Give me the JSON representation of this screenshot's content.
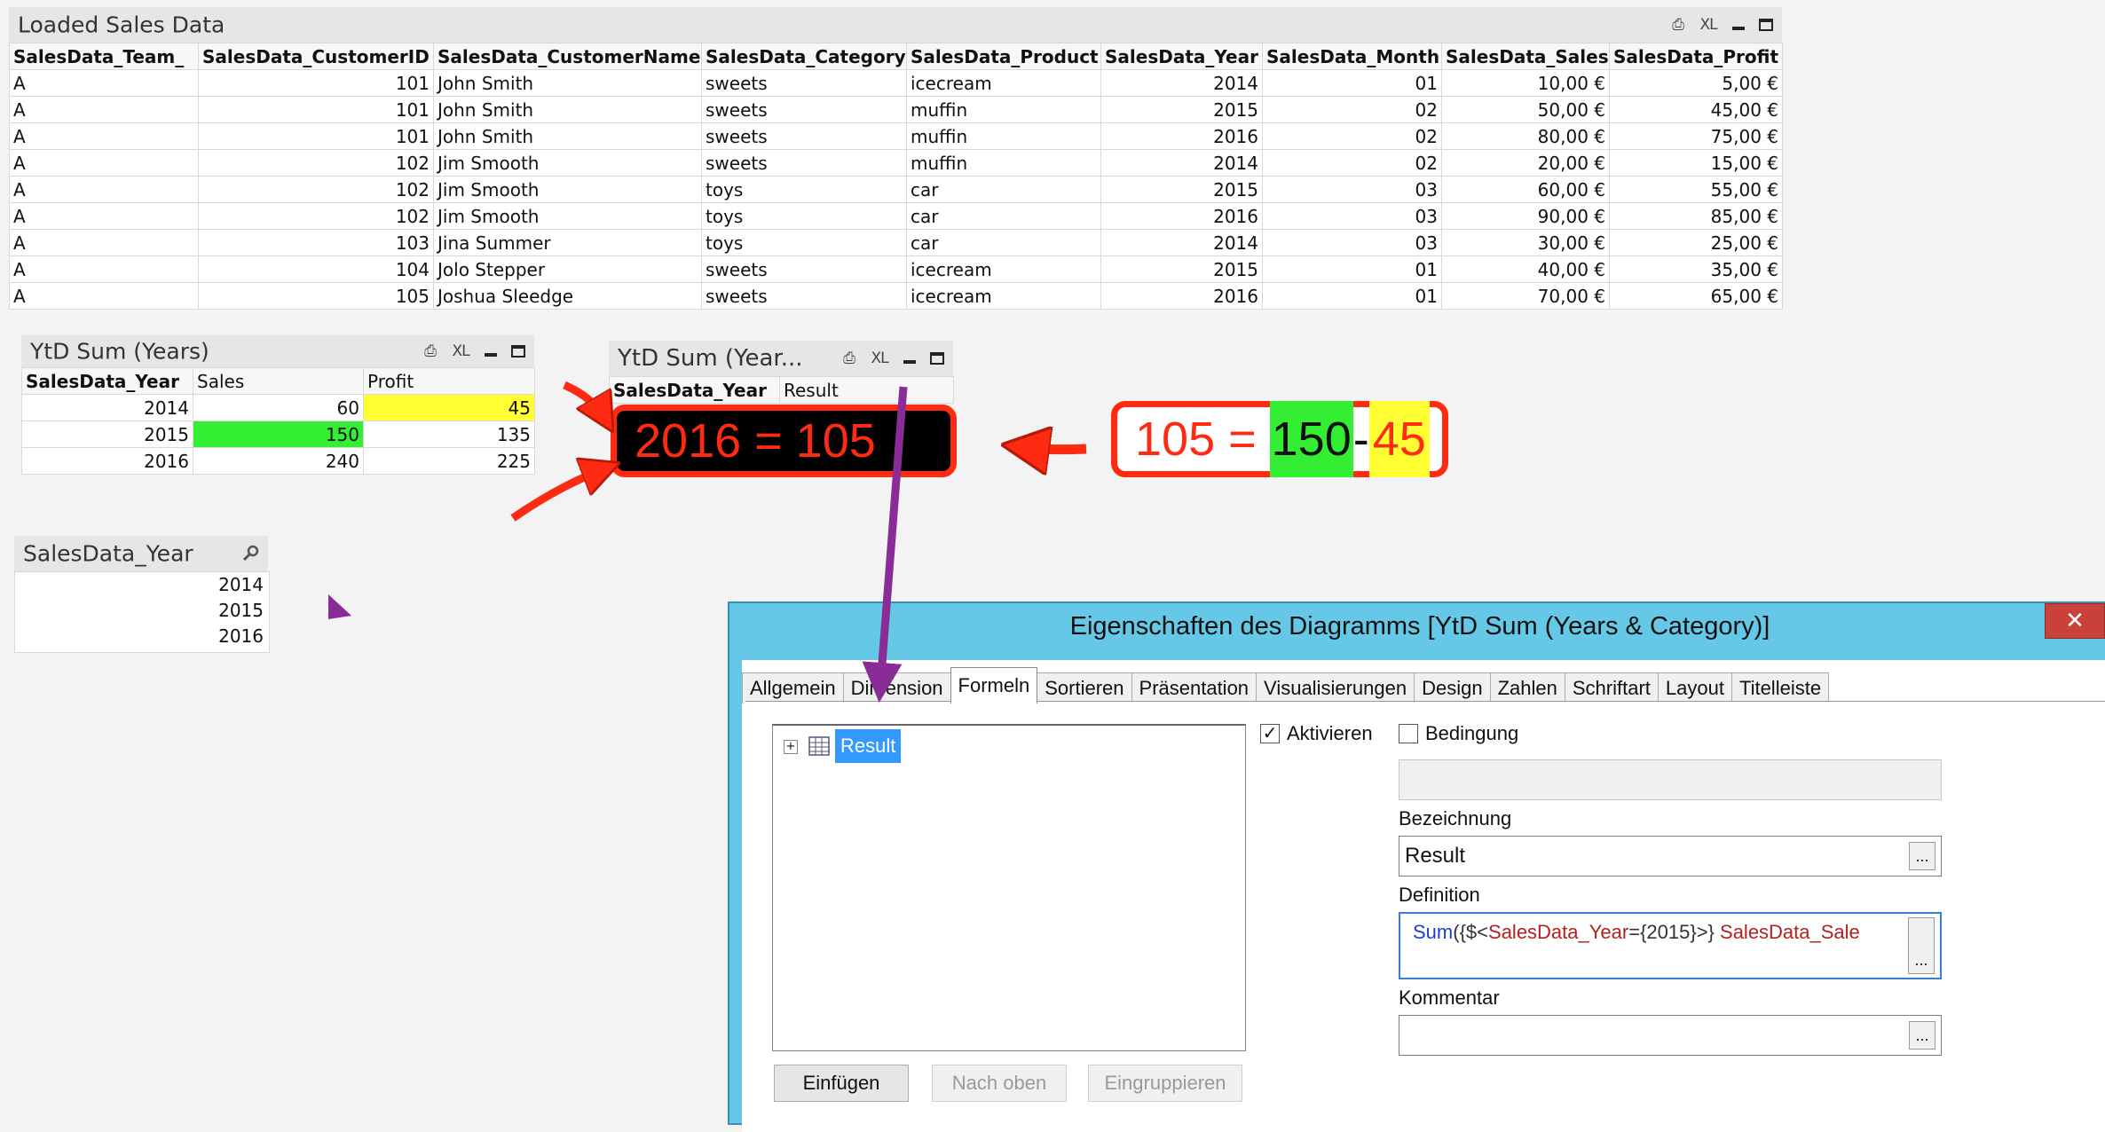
{
  "loaded_sales": {
    "title": "Loaded Sales Data",
    "icons": [
      "print-icon",
      "excel-icon",
      "minimize-icon",
      "maximize-icon"
    ],
    "xl_label": "XL",
    "columns": [
      "SalesData_Team_",
      "SalesData_CustomerID",
      "SalesData_CustomerName",
      "SalesData_Category",
      "SalesData_Product",
      "SalesData_Year",
      "SalesData_Month",
      "SalesData_Sales",
      "SalesData_Profit"
    ],
    "rows": [
      [
        "A",
        "101",
        "John Smith",
        "sweets",
        "icecream",
        "2014",
        "01",
        "10,00 €",
        "5,00 €"
      ],
      [
        "A",
        "101",
        "John Smith",
        "sweets",
        "muffin",
        "2015",
        "02",
        "50,00 €",
        "45,00 €"
      ],
      [
        "A",
        "101",
        "John Smith",
        "sweets",
        "muffin",
        "2016",
        "02",
        "80,00 €",
        "75,00 €"
      ],
      [
        "A",
        "102",
        "Jim Smooth",
        "sweets",
        "muffin",
        "2014",
        "02",
        "20,00 €",
        "15,00 €"
      ],
      [
        "A",
        "102",
        "Jim Smooth",
        "toys",
        "car",
        "2015",
        "03",
        "60,00 €",
        "55,00 €"
      ],
      [
        "A",
        "102",
        "Jim Smooth",
        "toys",
        "car",
        "2016",
        "03",
        "90,00 €",
        "85,00 €"
      ],
      [
        "A",
        "103",
        "Jina Summer",
        "toys",
        "car",
        "2014",
        "03",
        "30,00 €",
        "25,00 €"
      ],
      [
        "A",
        "104",
        "Jolo Stepper",
        "sweets",
        "icecream",
        "2015",
        "01",
        "40,00 €",
        "35,00 €"
      ],
      [
        "A",
        "105",
        "Joshua Sleedge",
        "sweets",
        "icecream",
        "2016",
        "01",
        "70,00 €",
        "65,00 €"
      ]
    ]
  },
  "ytd_years": {
    "title": "YtD Sum (Years)",
    "xl_label": "XL",
    "columns": [
      "SalesData_Year",
      "Sales",
      "Profit"
    ],
    "rows": [
      [
        "2014",
        "60",
        "45"
      ],
      [
        "2015",
        "150",
        "135"
      ],
      [
        "2016",
        "240",
        "225"
      ]
    ],
    "highlight_green": "#33ee33",
    "highlight_yellow": "#ffff33"
  },
  "ytd_category": {
    "title": "YtD Sum (Year...",
    "xl_label": "XL",
    "columns": [
      "SalesData_Year",
      "Result"
    ]
  },
  "year_listbox": {
    "title": "SalesData_Year",
    "values": [
      "2014",
      "2015",
      "2016"
    ]
  },
  "callout_result": {
    "text": "2016 = 105"
  },
  "callout_formula": {
    "prefix": "105 = ",
    "green_part": "150",
    "minus": "-",
    "yellow_part": "45"
  },
  "dialog": {
    "title": "Eigenschaften des Diagramms [YtD Sum (Years & Category)]",
    "close": "✕",
    "tabs": [
      "Allgemein",
      "Dimension",
      "Formeln",
      "Sortieren",
      "Präsentation",
      "Visualisierungen",
      "Design",
      "Zahlen",
      "Schriftart",
      "Layout",
      "Titelleiste"
    ],
    "active_tab": "Formeln",
    "tree_item": "Result",
    "activate_label": "Aktivieren",
    "condition_label": "Bedingung",
    "name_label": "Bezeichnung",
    "name_value": "Result",
    "definition_label": "Definition",
    "definition_func": "Sum",
    "definition_set": "({$<",
    "definition_field": "SalesData_Year",
    "definition_eq": "={2015}>} ",
    "definition_rest": "SalesData_Sale",
    "comment_label": "Kommentar",
    "btn_insert": "Einfügen",
    "btn_up": "Nach oben",
    "btn_group": "Eingruppieren",
    "dots": "..."
  },
  "colors": {
    "callout_red": "#ff2a12",
    "arrow_purple": "#8a2c97",
    "dialog_frame": "#64c8e6",
    "selection_blue": "#3399ff"
  }
}
